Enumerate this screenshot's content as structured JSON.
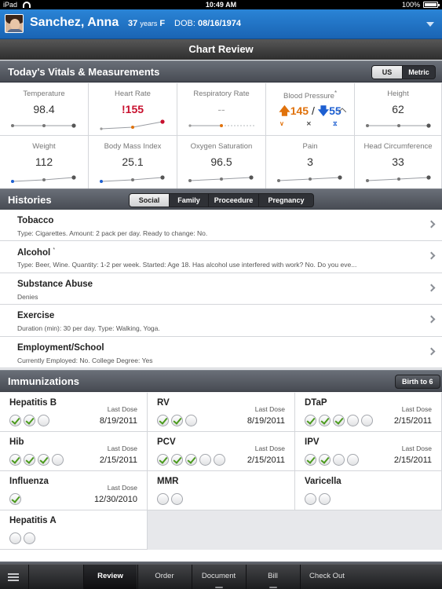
{
  "statusbar": {
    "carrier": "iPad",
    "time": "10:49 AM",
    "battery": "100%"
  },
  "patient": {
    "name": "Sanchez, Anna",
    "age": "37",
    "age_units": "years",
    "sex": "F",
    "dob_label": "DOB:",
    "dob": "08/16/1974"
  },
  "page_title": "Chart Review",
  "vitals": {
    "title": "Today's Vitals & Measurements",
    "units": {
      "options": [
        "US",
        "Metric"
      ],
      "selected": "US"
    },
    "cells": [
      {
        "label": "Temperature",
        "value": "98.4"
      },
      {
        "label": "Heart Rate",
        "value": "155",
        "alert": "!"
      },
      {
        "label": "Respiratory Rate",
        "value": "--"
      },
      {
        "label": "Blood Pressure",
        "marker": "*",
        "systolic": "145",
        "diastolic": "55",
        "separator": "/"
      },
      {
        "label": "Height",
        "value": "62"
      },
      {
        "label": "Weight",
        "value": "112"
      },
      {
        "label": "Body Mass Index",
        "value": "25.1"
      },
      {
        "label": "Oxygen Saturation",
        "value": "96.5"
      },
      {
        "label": "Pain",
        "value": "3"
      },
      {
        "label": "Head Circumference",
        "value": "33"
      }
    ]
  },
  "histories": {
    "title": "Histories",
    "tabs": [
      "Social",
      "Family",
      "Proceedure",
      "Pregnancy"
    ],
    "selected_tab": "Social",
    "items": [
      {
        "title": "Tobacco",
        "marker": "",
        "summary": "Type: Cigarettes.  Amount: 2 pack per day.  Ready to change: No."
      },
      {
        "title": "Alcohol",
        "marker": "*",
        "summary": "Type: Beer, Wine.  Quantity: 1-2 per week.  Started: Age 18.  Has alcohol use interfered with work? No.  Do you eve..."
      },
      {
        "title": "Substance Abuse",
        "marker": "",
        "summary": "Denies"
      },
      {
        "title": "Exercise",
        "marker": "",
        "summary": "Duration (min): 30 per day.  Type: Walking, Yoga."
      },
      {
        "title": "Employment/School",
        "marker": "",
        "summary": "Currently Employed: No.  College Degree: Yes"
      }
    ]
  },
  "immunizations": {
    "title": "Immunizations",
    "range_button": "Birth to 6",
    "last_dose_label": "Last Dose",
    "items": [
      {
        "name": "Hepatitis B",
        "doses_done": 2,
        "doses_total": 3,
        "last_dose": "8/19/2011"
      },
      {
        "name": "RV",
        "doses_done": 2,
        "doses_total": 3,
        "last_dose": "8/19/2011"
      },
      {
        "name": "DTaP",
        "doses_done": 3,
        "doses_total": 5,
        "last_dose": "2/15/2011"
      },
      {
        "name": "Hib",
        "doses_done": 3,
        "doses_total": 4,
        "last_dose": "2/15/2011"
      },
      {
        "name": "PCV",
        "doses_done": 3,
        "doses_total": 5,
        "last_dose": "2/15/2011"
      },
      {
        "name": "IPV",
        "doses_done": 2,
        "doses_total": 4,
        "last_dose": "2/15/2011"
      },
      {
        "name": "Influenza",
        "doses_done": 1,
        "doses_total": 1,
        "last_dose": "12/30/2010"
      },
      {
        "name": "MMR",
        "doses_done": 0,
        "doses_total": 2,
        "last_dose": ""
      },
      {
        "name": "Varicella",
        "doses_done": 0,
        "doses_total": 2,
        "last_dose": ""
      },
      {
        "name": "Hepatitis A",
        "doses_done": 0,
        "doses_total": 2,
        "last_dose": ""
      }
    ]
  },
  "tabbar": {
    "tabs": [
      "Review",
      "Order",
      "Document",
      "Bill",
      "Check Out"
    ],
    "selected": "Review"
  },
  "colors": {
    "brand_blue": "#1a64b4",
    "alert_red": "#c8102e",
    "bp_systolic": "#e0720c",
    "bp_diastolic": "#1d5fd1",
    "dose_check": "#4a9a1c"
  }
}
